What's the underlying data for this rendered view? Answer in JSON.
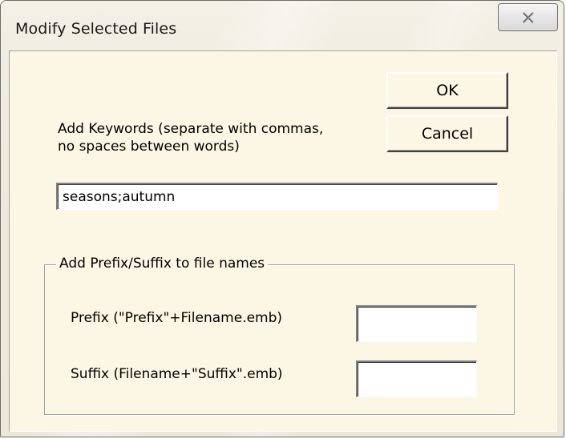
{
  "window": {
    "title": "Modify Selected Files",
    "close_icon": "close-icon"
  },
  "buttons": {
    "ok_label": "OK",
    "cancel_label": "Cancel"
  },
  "keywords": {
    "label_line1": "Add Keywords (separate with commas,",
    "label_line2": "no spaces between words)",
    "value": "seasons;autumn"
  },
  "prefix_suffix_group": {
    "legend": "Add Prefix/Suffix to file names",
    "prefix_label": "Prefix (\"Prefix\"+Filename.emb)",
    "prefix_value": "",
    "suffix_label": "Suffix (Filename+\"Suffix\".emb)",
    "suffix_value": ""
  },
  "colors": {
    "client_background": "#fcf7e4",
    "frame_background": "#efe9dc"
  }
}
